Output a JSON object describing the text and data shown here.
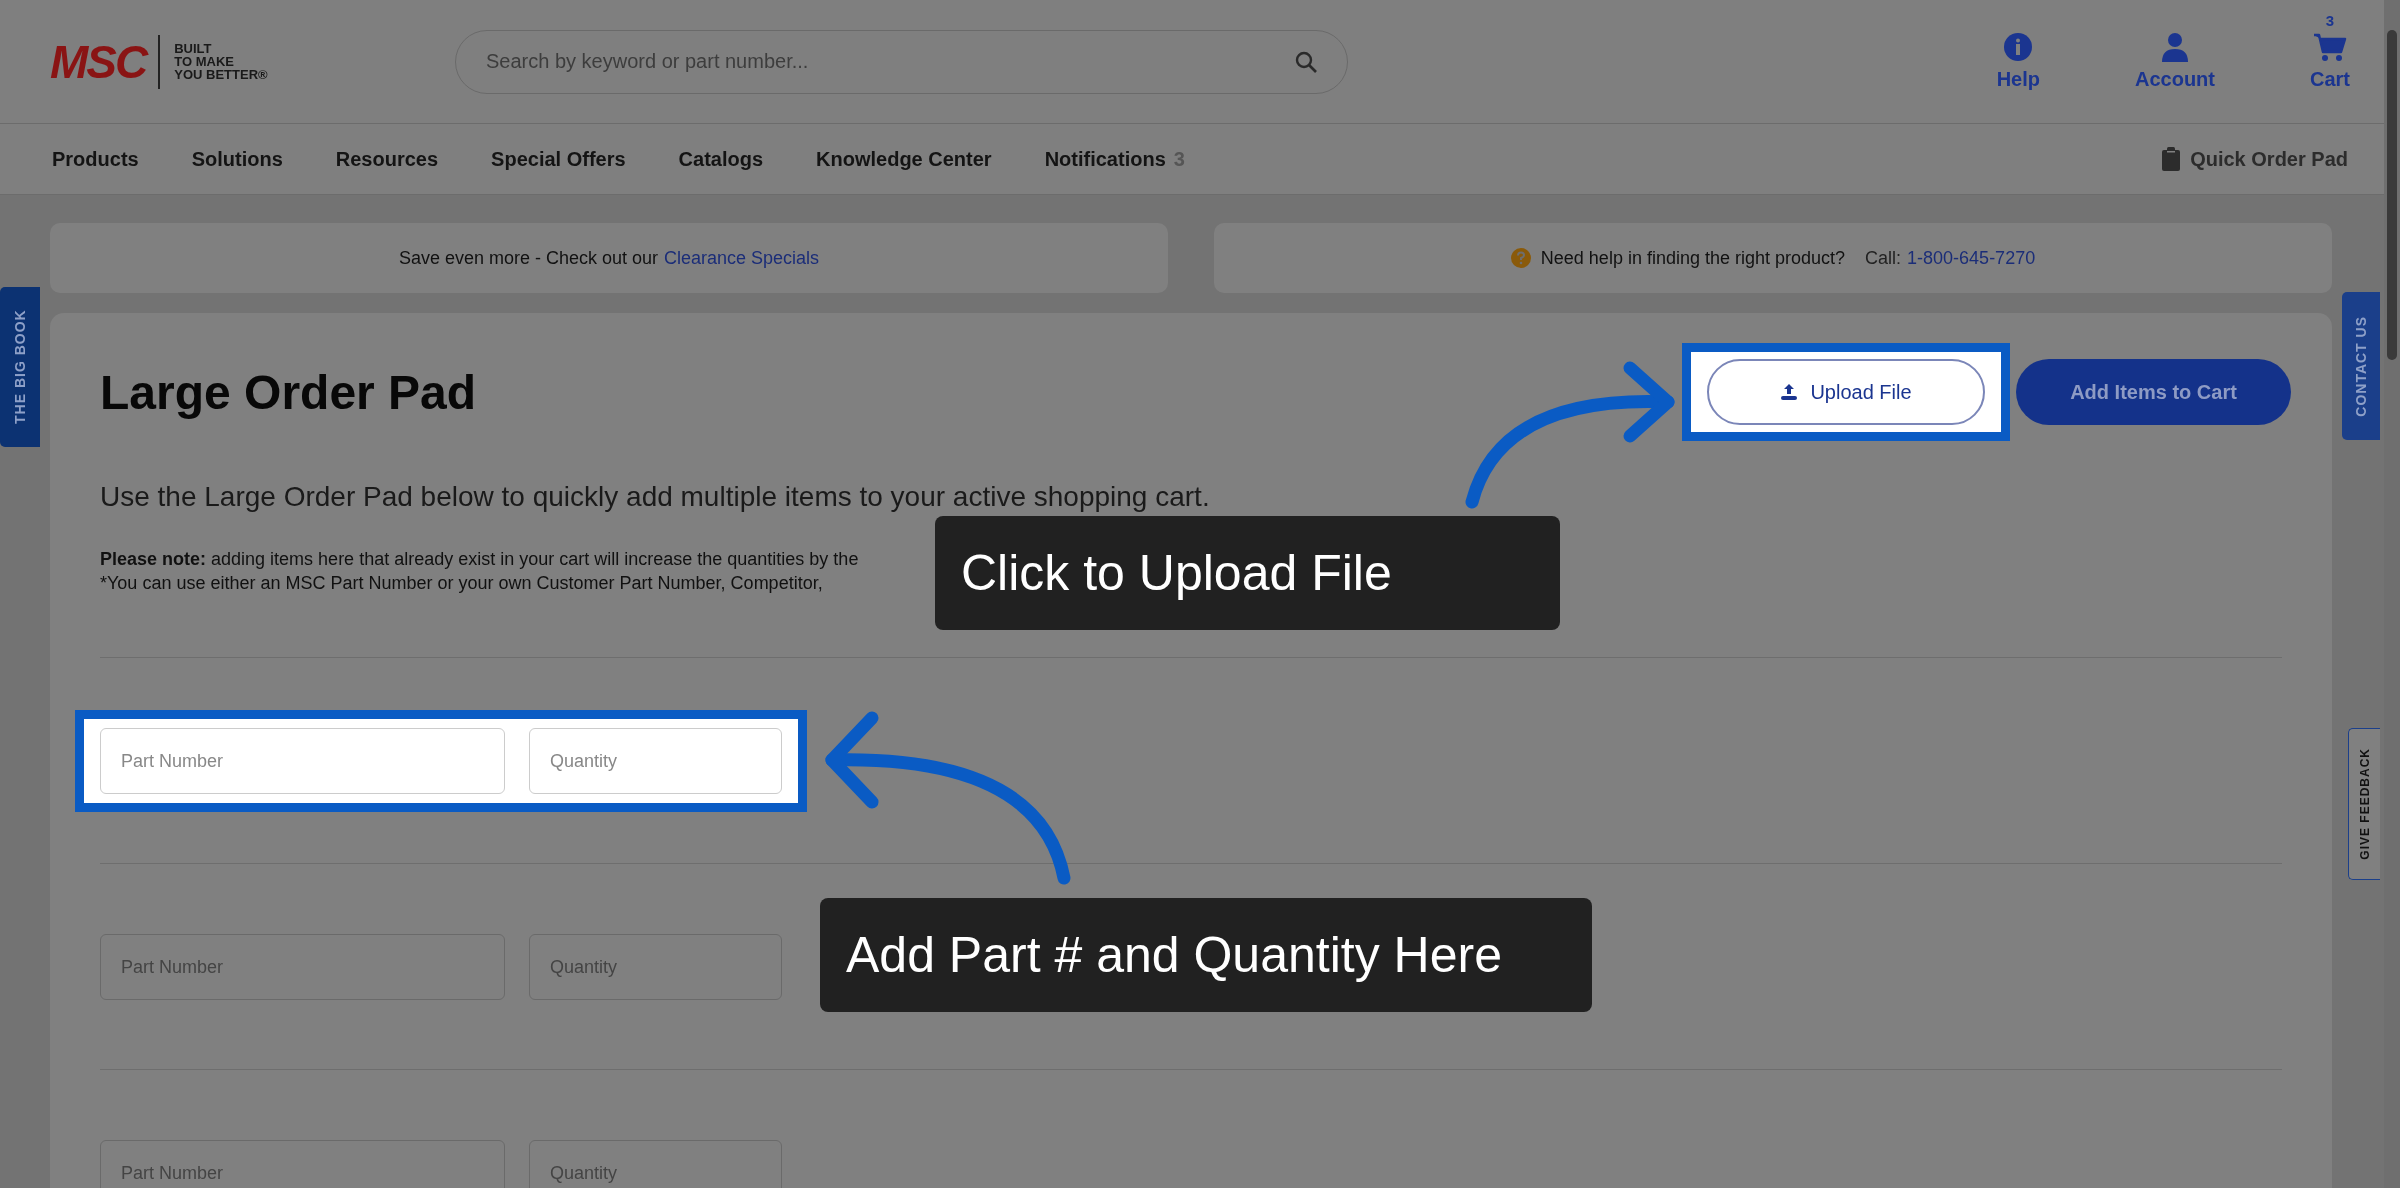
{
  "header": {
    "logo": {
      "brand": "MSC",
      "tagline": [
        "BUILT",
        "TO MAKE",
        "YOU BETTER®"
      ]
    },
    "search": {
      "placeholder": "Search by keyword or part number..."
    },
    "actions": [
      {
        "kind": "help",
        "label": "Help"
      },
      {
        "kind": "account",
        "label": "Account"
      },
      {
        "kind": "cart",
        "label": "Cart",
        "badge": "3"
      }
    ]
  },
  "nav": {
    "items": [
      {
        "label": "Products"
      },
      {
        "label": "Solutions"
      },
      {
        "label": "Resources"
      },
      {
        "label": "Special Offers"
      },
      {
        "label": "Catalogs"
      },
      {
        "label": "Knowledge Center"
      },
      {
        "label": "Notifications",
        "count": "3"
      }
    ],
    "quick_order": "Quick Order Pad"
  },
  "banners": {
    "promo": {
      "text": "Save even more - Check out our",
      "link": "Clearance Specials"
    },
    "help": {
      "text": "Need help in finding the right product?",
      "call_label": "Call:",
      "phone": "1-800-645-7270"
    }
  },
  "side_tabs": {
    "left": "THE BIG BOOK",
    "contact": "CONTACT US",
    "feedback": "GIVE FEEDBACK"
  },
  "page": {
    "title": "Large Order Pad",
    "intro": "Use the Large Order Pad below to quickly add multiple items to your active shopping cart.",
    "notes": [
      "**Please note:** adding items here that already exist in your cart will increase the quantities by the",
      "*You can use either an MSC Part Number or your own Customer Part Number, Competitor,"
    ],
    "buttons": [
      {
        "kind": "upload",
        "label": "Upload File",
        "highlighted": true
      },
      {
        "kind": "add",
        "label": "Add Items to Cart",
        "highlighted": false
      }
    ],
    "rows": [
      {
        "part_placeholder": "Part Number",
        "quantity_placeholder": "Quantity",
        "highlighted": true
      },
      {
        "part_placeholder": "Part Number",
        "quantity_placeholder": "Quantity",
        "highlighted": false
      },
      {
        "part_placeholder": "Part Number",
        "quantity_placeholder": "Quantity",
        "highlighted": false
      }
    ]
  },
  "callouts": [
    {
      "text": "Click to Upload File"
    },
    {
      "text": "Add Part # and Quantity Here"
    }
  ]
}
